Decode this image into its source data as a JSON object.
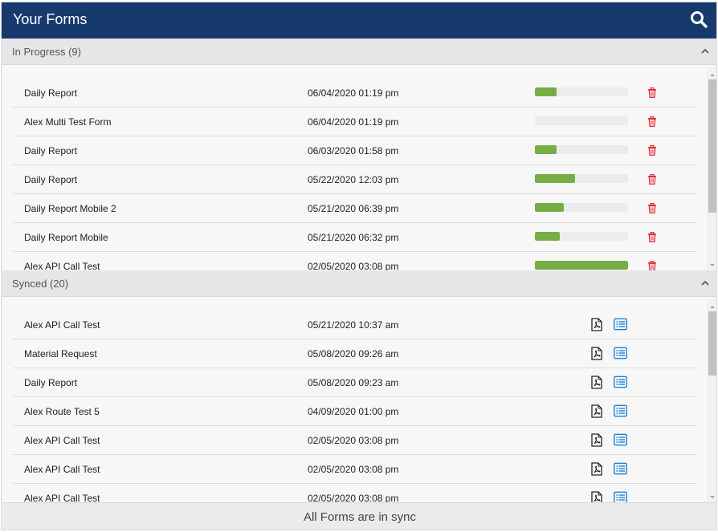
{
  "header": {
    "title": "Your Forms",
    "search_icon": "search-icon"
  },
  "in_progress": {
    "label": "In Progress (9)",
    "rows": [
      {
        "name": "Daily Report",
        "date": "06/04/2020 01:19 pm",
        "progress": 0.23
      },
      {
        "name": "Alex Multi Test Form",
        "date": "06/04/2020 01:19 pm",
        "progress": 0
      },
      {
        "name": "Daily Report",
        "date": "06/03/2020 01:58 pm",
        "progress": 0.23
      },
      {
        "name": "Daily Report",
        "date": "05/22/2020 12:03 pm",
        "progress": 0.43
      },
      {
        "name": "Daily Report Mobile 2",
        "date": "05/21/2020 06:39 pm",
        "progress": 0.31
      },
      {
        "name": "Daily Report Mobile",
        "date": "05/21/2020 06:32 pm",
        "progress": 0.27
      },
      {
        "name": "Alex API Call Test",
        "date": "02/05/2020 03:08 pm",
        "progress": 1.0
      }
    ]
  },
  "synced": {
    "label": "Synced (20)",
    "rows": [
      {
        "name": "Alex API Call Test",
        "date": "05/21/2020 10:37 am"
      },
      {
        "name": "Material Request",
        "date": "05/08/2020 09:26 am"
      },
      {
        "name": "Daily Report",
        "date": "05/08/2020 09:23 am"
      },
      {
        "name": "Alex Route Test 5",
        "date": "04/09/2020 01:00 pm"
      },
      {
        "name": "Alex API Call Test",
        "date": "02/05/2020 03:08 pm"
      },
      {
        "name": "Alex API Call Test",
        "date": "02/05/2020 03:08 pm"
      },
      {
        "name": "Alex API Call Test",
        "date": "02/05/2020 03:08 pm"
      }
    ]
  },
  "footer": {
    "message": "All Forms are in sync"
  },
  "colors": {
    "header_bg": "#163a6e",
    "progress_fill": "#76ad45",
    "delete": "#e0303a",
    "detail": "#1e7fd8"
  }
}
